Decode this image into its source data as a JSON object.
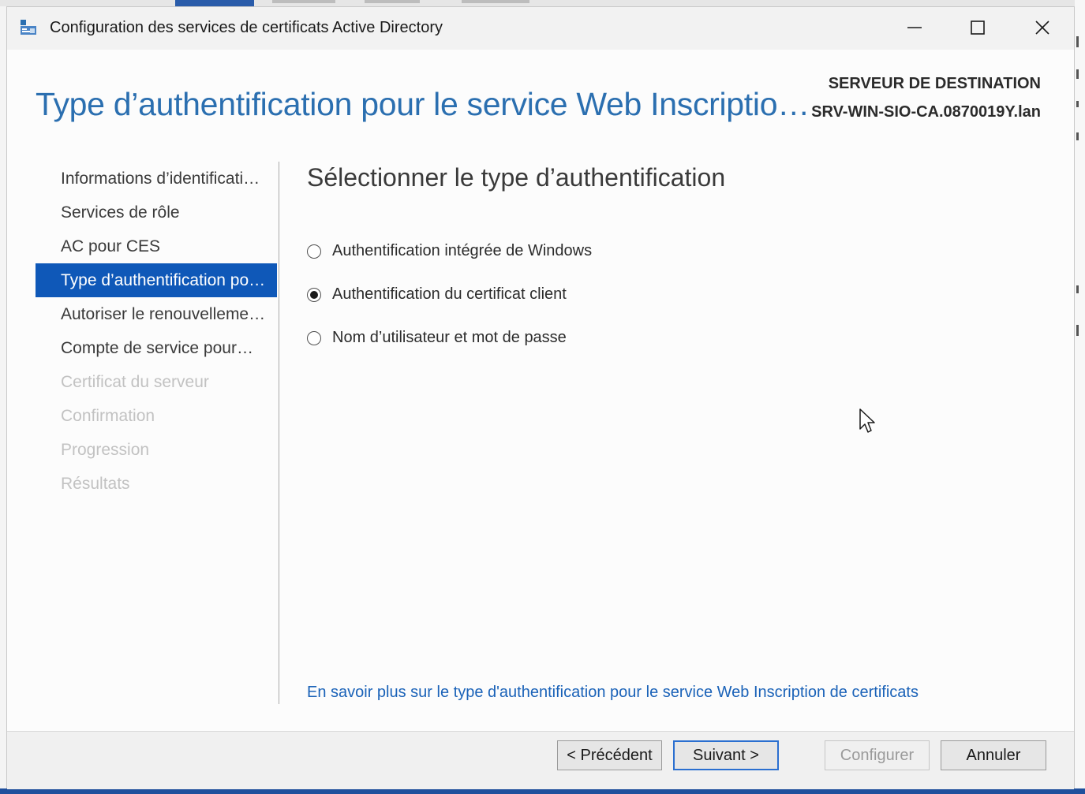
{
  "window": {
    "title": "Configuration des services de certificats Active Directory",
    "controls": [
      "minimize-icon",
      "maximize-icon",
      "close-icon"
    ]
  },
  "header": {
    "page_title": "Type d’authentification pour le service Web Inscriptio…",
    "destination_label": "SERVEUR DE DESTINATION",
    "destination_server": "SRV-WIN-SIO-CA.0870019Y.lan"
  },
  "nav": {
    "items": [
      {
        "label": "Informations d’identificati…",
        "state": "normal"
      },
      {
        "label": "Services de rôle",
        "state": "normal"
      },
      {
        "label": "AC pour CES",
        "state": "normal"
      },
      {
        "label": "Type d’authentification po…",
        "state": "active"
      },
      {
        "label": "Autoriser le renouvelleme…",
        "state": "normal"
      },
      {
        "label": "Compte de service pour…",
        "state": "normal"
      },
      {
        "label": "Certificat du serveur",
        "state": "disabled"
      },
      {
        "label": "Confirmation",
        "state": "disabled"
      },
      {
        "label": "Progression",
        "state": "disabled"
      },
      {
        "label": "Résultats",
        "state": "disabled"
      }
    ]
  },
  "main": {
    "section_title": "Sélectionner le type d’authentification",
    "options": [
      {
        "label": "Authentification intégrée de Windows",
        "selected": false
      },
      {
        "label": "Authentification du certificat client",
        "selected": true
      },
      {
        "label": "Nom d’utilisateur et mot de passe",
        "selected": false
      }
    ],
    "help_link": "En savoir plus sur le type d'authentification pour le service Web Inscription de certificats"
  },
  "footer": {
    "previous": "< Précédent",
    "next": "Suivant >",
    "configure": "Configurer",
    "cancel": "Annuler"
  },
  "colors": {
    "accent": "#0f58b8",
    "title_blue": "#2b6fb0",
    "link_blue": "#1a62b8"
  }
}
